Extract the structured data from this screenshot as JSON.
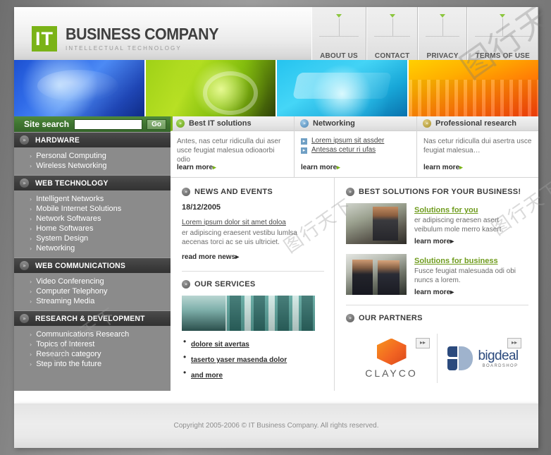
{
  "site": {
    "logo_mark": "IT",
    "title": "BUSINESS COMPANY",
    "tagline": "INTELLECTUAL TECHNOLOGY"
  },
  "topnav": [
    {
      "label": "ABOUT US"
    },
    {
      "label": "CONTACT"
    },
    {
      "label": "PRIVACY"
    },
    {
      "label": "TERMS OF USE"
    }
  ],
  "search": {
    "label": "Site search",
    "value": "",
    "placeholder": "",
    "button": "Go"
  },
  "sidebar": {
    "sections": [
      {
        "title": "HARDWARE",
        "items": [
          "Personal Computing",
          "Wireless Networking"
        ]
      },
      {
        "title": "WEB TECHNOLOGY",
        "items": [
          "Intelligent Networks",
          "Mobile Internet Solutions",
          "Network Softwares",
          "Home Softwares",
          "System Design",
          "Networking"
        ]
      },
      {
        "title": "WEB COMMUNICATIONS",
        "items": [
          "Video Conferencing",
          "Computer Telephony",
          "Streaming Media"
        ]
      },
      {
        "title": "RESEARCH & DEVELOPMENT",
        "items": [
          "Communications Research",
          "Topics of Interest",
          "Research category",
          "Step into the future"
        ]
      }
    ]
  },
  "promos": [
    {
      "title": "Best IT solutions",
      "text": "Antes, nas cetur ridiculla dui aser usce feugiat malesua odioaorbi odio",
      "links": [],
      "more": "learn more"
    },
    {
      "title": "Networking",
      "text": "",
      "links": [
        "Lorem ipsum sit assder",
        "Antesas cetur ri ufas"
      ],
      "more": "learn more"
    },
    {
      "title": "Professional research",
      "text": "Nas cetur ridiculla dui asertra usce feugiat malesua…",
      "links": [],
      "more": "learn more"
    }
  ],
  "news": {
    "heading": "NEWS AND EVENTS",
    "date": "18/12/2005",
    "link": "Lorem ipsum dolor sit amet doloa",
    "body": "er adipiscing eraesent vestibu lumlsa aecenas torci ac se uis ultriciet.",
    "more": "read more news"
  },
  "services": {
    "heading": "OUR SERVICES",
    "items": [
      "dolore sit avertas",
      "taserto yaser masenda dolor",
      "and more"
    ]
  },
  "solutions": {
    "heading": "BEST SOLUTIONS FOR YOUR BUSINESS!",
    "items": [
      {
        "title": "Solutions for you",
        "text": "er adipiscing eraesen asert veibulum mole merro kasert.",
        "more": "learn more"
      },
      {
        "title": "Solutions for business",
        "text": "Fusce feugiat malesuada odi obi nuncs a lorem.",
        "more": "learn more"
      }
    ]
  },
  "partners": {
    "heading": "OUR PARTNERS",
    "items": [
      {
        "name": "CLAYCO",
        "sub": "",
        "button": "▸▸"
      },
      {
        "name": "bigdeal",
        "sub": "BOARDSHOP",
        "button": "▸▸"
      }
    ]
  },
  "footer": {
    "copyright": "Copyright 2005-2006 © IT Business Company. All rights reserved."
  },
  "icons": {
    "chevron": "»",
    "bullet": "›",
    "arrow_right": "▸"
  },
  "colors": {
    "accent_green": "#7ab317",
    "search_green": "#3f7430",
    "sidebar_grey": "#8b8b8b",
    "nav_dark": "#3c3c3c",
    "link_green": "#6f9c1d"
  },
  "watermarks": [
    "图行天下",
    "图行天下",
    "图行天下",
    "图行天下"
  ]
}
